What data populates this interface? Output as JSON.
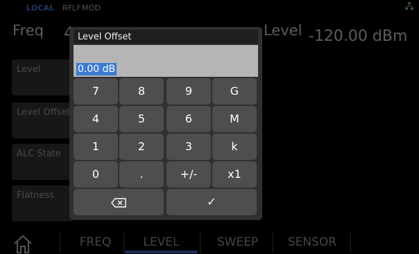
{
  "status": {
    "local": "LOCAL",
    "rf": "RF",
    "lf": "LF",
    "mod": "MOD"
  },
  "main": {
    "freq_label": "Freq",
    "freq_value": "4",
    "level_label": "Level",
    "level_value": "-120.00 dBm"
  },
  "side_buttons": [
    "Level",
    "Level Offset",
    "ALC State",
    "Flatness"
  ],
  "bottom_nav": {
    "freq": "FREQ",
    "level": "LEVEL",
    "sweep": "SWEEP",
    "sensor": "SENSOR"
  },
  "dialog": {
    "title": "Level Offset",
    "value": "0.00 dB",
    "keys": {
      "k7": "7",
      "k8": "8",
      "k9": "9",
      "kG": "G",
      "k4": "4",
      "k5": "5",
      "k6": "6",
      "kM": "M",
      "k1": "1",
      "k2": "2",
      "k3": "3",
      "kk": "k",
      "k0": "0",
      "kdot": ".",
      "kpm": "+/-",
      "kx1": "x1",
      "enter": "✓"
    }
  },
  "colors": {
    "accent": "#3d7ad0",
    "local": "#1e3a66",
    "dialog_bg": "#303030",
    "key_bg": "#4e4e4e",
    "entry_bg": "#b5b5b5"
  },
  "icons": [
    "network-icon",
    "home-icon",
    "backspace-icon",
    "checkmark-icon"
  ]
}
